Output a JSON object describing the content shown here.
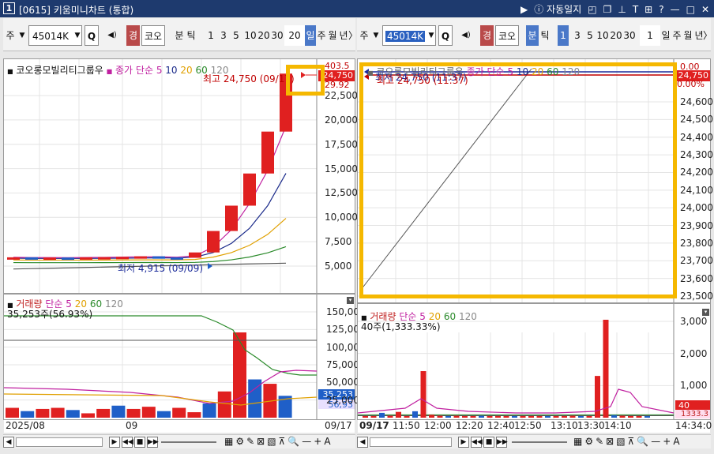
{
  "window": {
    "id_badge": "1",
    "title": "[0615] 키움미니차트 (통합)",
    "auto_log_label": "자동일지",
    "controls": [
      "▶",
      "ⓘ",
      "□",
      "▣",
      "⊤",
      "T",
      "⊞",
      "?",
      "—",
      "□",
      "✕"
    ]
  },
  "left": {
    "toolbar": {
      "market": "주",
      "dropdown": "▼",
      "code": "45014K",
      "search": "Q",
      "sound": "◀)",
      "gyeong": "경",
      "name": "코오",
      "period": "분",
      "tick": "틱",
      "intervals": [
        "1",
        "3",
        "5",
        "10",
        "20",
        "30",
        "20"
      ],
      "day": "일",
      "week": "주",
      "month": "월",
      "year": "년",
      "next": "〉"
    },
    "price_chart": {
      "legend": {
        "name": "코오롱모빌리티그룹우",
        "ma_label": "종가 단순",
        "ma": [
          "5",
          "10",
          "20",
          "60",
          "120"
        ]
      },
      "max_note": "최고 24,750 (09/17)",
      "min_note": "최저 4,915 (09/09)",
      "price_badge": "24,750",
      "top_clip": "403.5",
      "pct_clip": "29.92",
      "y_ticks": [
        "22,500",
        "20,000",
        "17,500",
        "15,000",
        "12,500",
        "10,000",
        "7,500",
        "5,000"
      ],
      "candles": [
        5900,
        5850,
        5880,
        5860,
        5900,
        5920,
        5950,
        6000,
        5900,
        5850,
        6400,
        8600,
        11200,
        14500,
        18800,
        24750
      ],
      "colors": {
        "up": "#e02020",
        "down": "#1f5fc8",
        "ma5": "#c020a0",
        "ma10": "#1a2a8a",
        "ma20": "#e0a000",
        "ma60": "#2a8a2a",
        "ma120": "#555555"
      }
    },
    "volume_chart": {
      "legend": {
        "name": "거래량",
        "ma_label": "단순",
        "ma": [
          "5",
          "20",
          "60",
          "120"
        ]
      },
      "current": "35,253주(56.93%)",
      "y_ticks": [
        "150,000",
        "125,000",
        "100,000",
        "75,000",
        "50,000",
        "25,000"
      ],
      "badges": [
        "35,253",
        "56,93"
      ],
      "bars": [
        9000,
        6000,
        8000,
        9000,
        7000,
        4000,
        8000,
        11000,
        8000,
        10000,
        6000,
        9000,
        5000,
        13000,
        24000,
        78000,
        35000,
        31000,
        20000
      ]
    },
    "dates": [
      "2025/08",
      "09",
      "09/17"
    ]
  },
  "right": {
    "toolbar": {
      "market": "주",
      "dropdown": "▼",
      "code": "45014K",
      "search": "Q",
      "sound": "◀)",
      "gyeong": "경",
      "name": "코오",
      "period": "분",
      "tick": "틱",
      "intervals": [
        "1",
        "3",
        "5",
        "10",
        "20",
        "30",
        "1"
      ],
      "day": "일",
      "week": "주",
      "month": "월",
      "year": "년",
      "next": "〉"
    },
    "price_chart": {
      "legend": {
        "name": "코오롱모빌리티그룹우",
        "ma_label": "종가 단순",
        "ma": [
          "5",
          "10",
          "20",
          "60",
          "120"
        ]
      },
      "max_note": "최고 24,750 (11:37)",
      "min_note": "최저 24,750 (11:37)",
      "price_badge": "24,750",
      "top_clip": "0.00",
      "pct_clip": "0.00%",
      "y_ticks": [
        "24,600",
        "24,500",
        "24,400",
        "24,300",
        "24,200",
        "24,100",
        "24,000",
        "23,900",
        "23,800",
        "23,700",
        "23,600",
        "23,500"
      ]
    },
    "volume_chart": {
      "legend": {
        "name": "거래량",
        "ma_label": "단순",
        "ma": [
          "5",
          "20",
          "60",
          "120"
        ]
      },
      "current": "40주(1,333.33%)",
      "y_ticks": [
        "3,000",
        "2,000",
        "1,000"
      ],
      "badges": [
        "40",
        "1333.3"
      ],
      "bars": [
        30,
        20,
        150,
        60,
        180,
        40,
        200,
        1450,
        90,
        60,
        40,
        60,
        30,
        40,
        60,
        30,
        50,
        30,
        20,
        40,
        30,
        30,
        40,
        20,
        30,
        60,
        40,
        30,
        1300,
        3050,
        80,
        60,
        50,
        40,
        40
      ]
    },
    "times": [
      "09/17",
      "11:50",
      "12:00",
      "12:20",
      "12:40",
      "12:50",
      "13:10",
      "13:30",
      "14:10",
      "14:34:0"
    ]
  }
}
